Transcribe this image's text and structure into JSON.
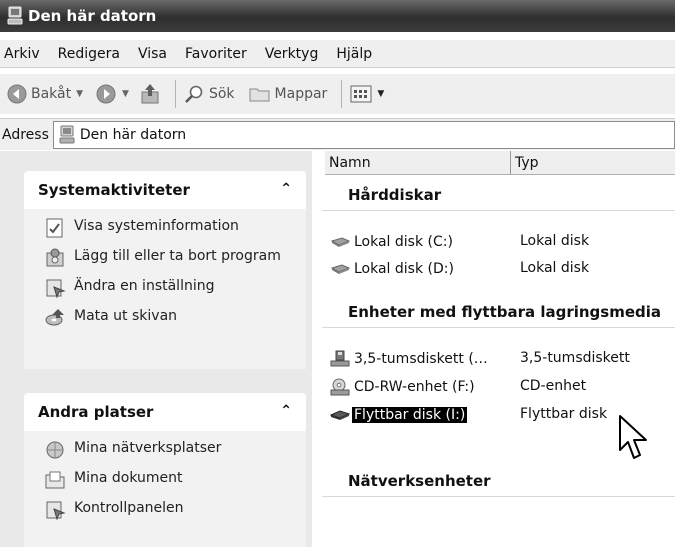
{
  "window": {
    "title": "Den här datorn"
  },
  "menu": [
    "Arkiv",
    "Redigera",
    "Visa",
    "Favoriter",
    "Verktyg",
    "Hjälp"
  ],
  "toolbar": {
    "back": "Bakåt",
    "search": "Sök",
    "folders": "Mappar"
  },
  "address": {
    "label": "Adress",
    "value": "Den här datorn"
  },
  "system_tasks": {
    "title": "Systemaktiviteter",
    "items": [
      "Visa systeminformation",
      "Lägg till eller ta bort program",
      "Ändra en inställning",
      "Mata ut skivan"
    ]
  },
  "other_places": {
    "title": "Andra platser",
    "items": [
      "Mina nätverksplatser",
      "Mina dokument",
      "Kontrollpanelen"
    ]
  },
  "columns": {
    "name": "Namn",
    "type": "Typ"
  },
  "groups": {
    "hard_disks": {
      "title": "Hårddiskar",
      "items": [
        {
          "name": "Lokal disk (C:)",
          "type": "Lokal disk"
        },
        {
          "name": "Lokal disk (D:)",
          "type": "Lokal disk"
        }
      ]
    },
    "removable": {
      "title": "Enheter med flyttbara lagringsmedia",
      "items": [
        {
          "name": "3,5-tumsdiskett (…",
          "type": "3,5-tumsdiskett"
        },
        {
          "name": "CD-RW-enhet (F:)",
          "type": "CD-enhet"
        },
        {
          "name": "Flyttbar disk (I:)",
          "type": "Flyttbar disk",
          "selected": true
        }
      ]
    },
    "network": {
      "title": "Nätverksenheter"
    }
  }
}
